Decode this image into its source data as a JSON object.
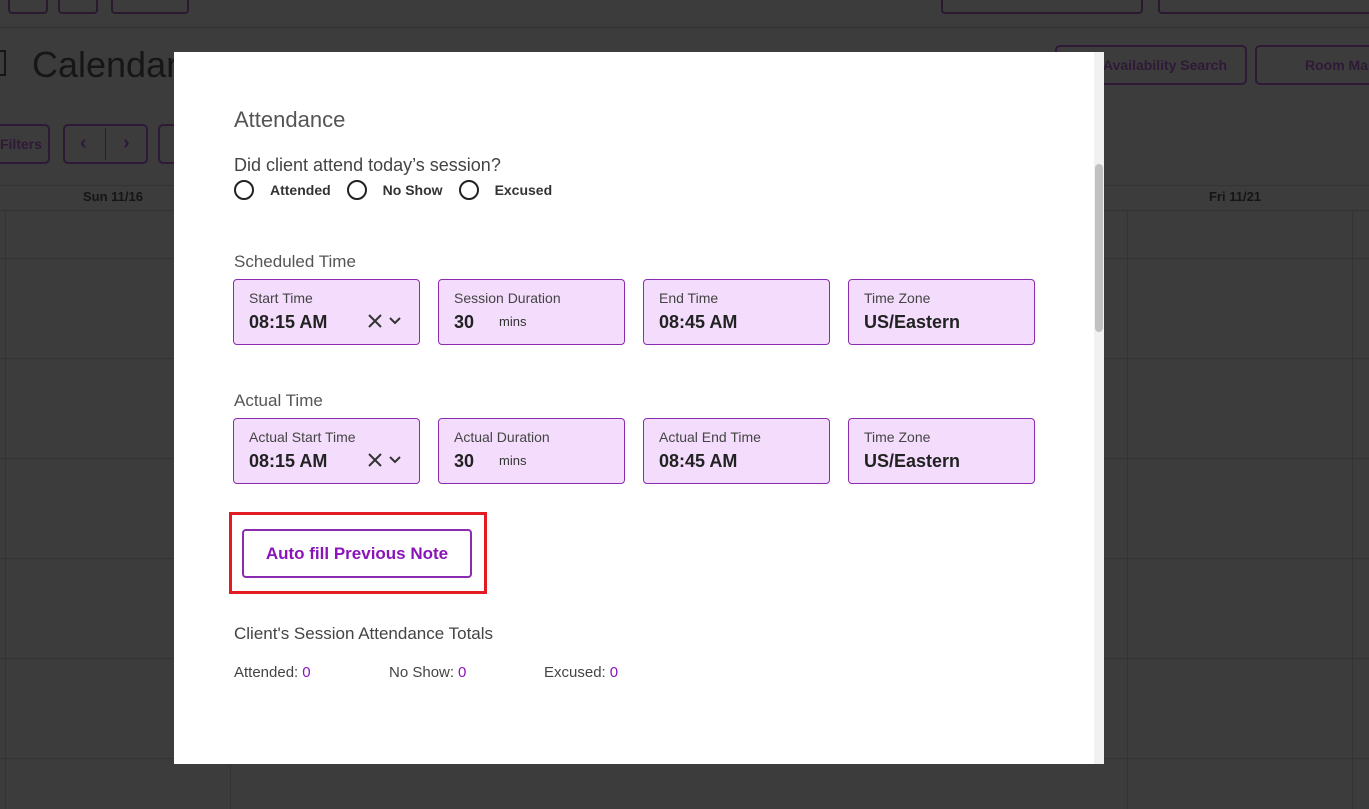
{
  "background": {
    "page_title": "Calendar",
    "buttons": {
      "availability_search": "Availability Search",
      "room_management": "Room Ma",
      "filters": "Filters",
      "prev": "‹",
      "next": "›"
    },
    "days": [
      "Sun 11/16",
      "Fri 11/21"
    ]
  },
  "modal": {
    "attendance": {
      "title": "Attendance",
      "question": "Did client attend today’s session?",
      "options": [
        "Attended",
        "No Show",
        "Excused"
      ]
    },
    "scheduled": {
      "title": "Scheduled Time",
      "start_time": {
        "label": "Start Time",
        "value": "08:15 AM"
      },
      "duration": {
        "label": "Session Duration",
        "value": "30",
        "unit": "mins"
      },
      "end_time": {
        "label": "End Time",
        "value": "08:45 AM"
      },
      "time_zone": {
        "label": "Time Zone",
        "value": "US/Eastern"
      }
    },
    "actual": {
      "title": "Actual Time",
      "start_time": {
        "label": "Actual Start Time",
        "value": "08:15 AM"
      },
      "duration": {
        "label": "Actual Duration",
        "value": "30",
        "unit": "mins"
      },
      "end_time": {
        "label": "Actual End Time",
        "value": "08:45 AM"
      },
      "time_zone": {
        "label": "Time Zone",
        "value": "US/Eastern"
      }
    },
    "autofill_button": "Auto fill Previous Note",
    "totals": {
      "title": "Client's Session Attendance Totals",
      "attended_label": "Attended:",
      "attended_count": "0",
      "no_show_label": "No Show:",
      "no_show_count": "0",
      "excused_label": "Excused:",
      "excused_count": "0"
    }
  },
  "colors": {
    "accent": "#8a14b8",
    "field_bg": "#f4ddfc",
    "highlight": "#e31b23",
    "overlay": "#3c3c3c"
  }
}
